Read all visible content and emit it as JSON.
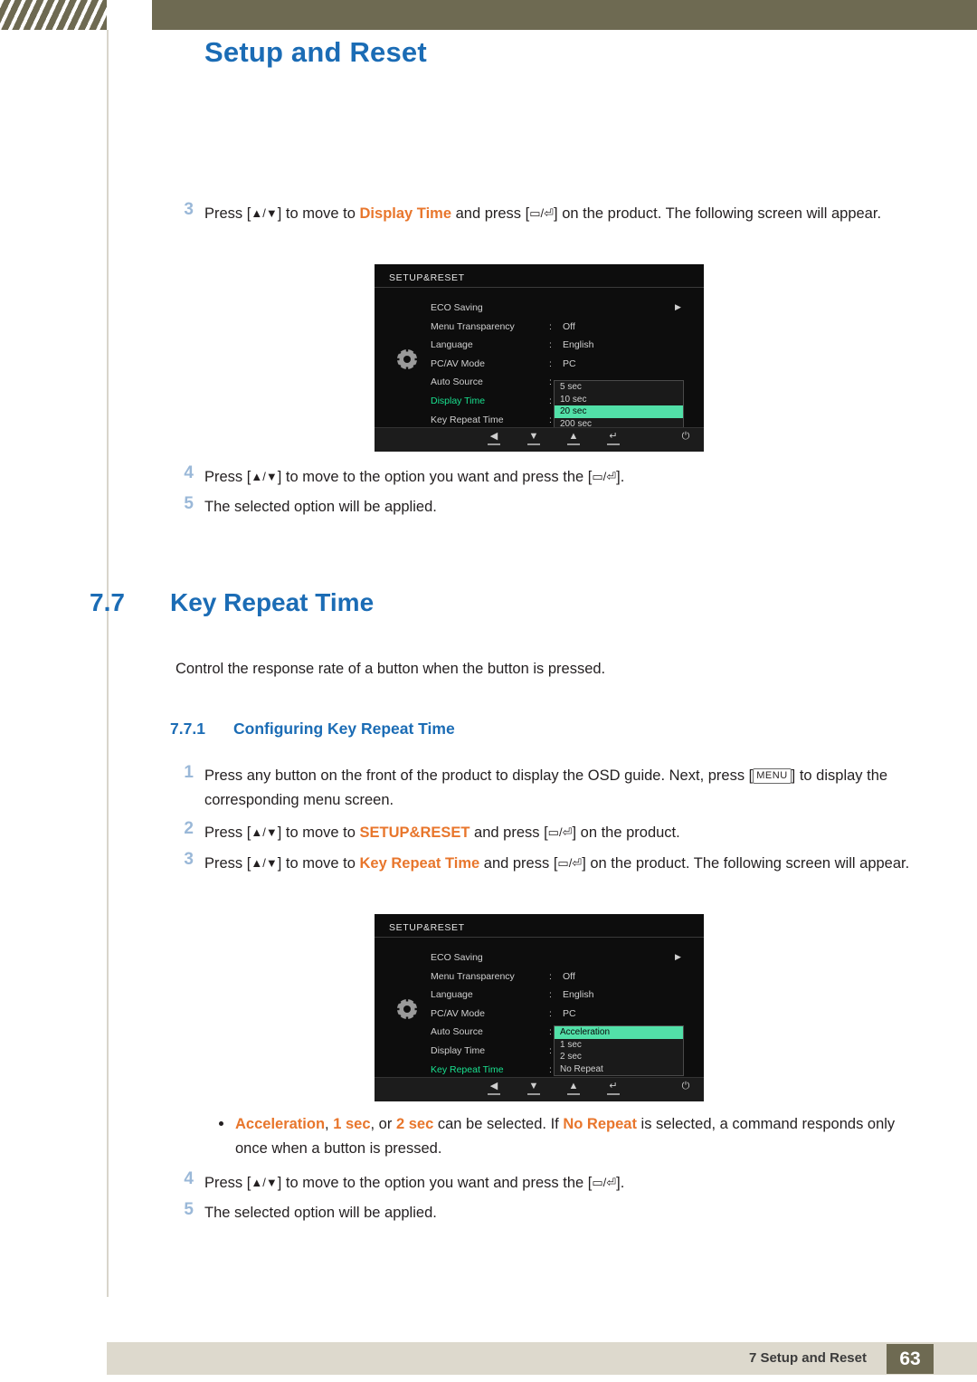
{
  "header": {
    "chapter_title": "Setup and Reset"
  },
  "steps_top": {
    "s3_num": "3",
    "s3_text_a": "Press [",
    "s3_text_b": "] to move to ",
    "s3_display_time": "Display Time",
    "s3_text_c": " and press [",
    "s3_text_d": "] on the product. The following screen will appear.",
    "s4_num": "4",
    "s4_text_a": "Press [",
    "s4_text_b": "] to move to the option you want and press the [",
    "s4_text_c": "].",
    "s5_num": "5",
    "s5_text": "The selected option will be applied."
  },
  "osd_display_time": {
    "title": "SETUP&RESET",
    "rows": [
      {
        "label": "ECO Saving",
        "colon": "",
        "value": "",
        "arrow": "▶",
        "selected": false
      },
      {
        "label": "Menu Transparency",
        "colon": ":",
        "value": "Off",
        "arrow": "",
        "selected": false
      },
      {
        "label": "Language",
        "colon": ":",
        "value": "English",
        "arrow": "",
        "selected": false
      },
      {
        "label": "PC/AV Mode",
        "colon": ":",
        "value": "PC",
        "arrow": "",
        "selected": false
      },
      {
        "label": "Auto Source",
        "colon": ":",
        "value": "",
        "arrow": "",
        "selected": false
      },
      {
        "label": "Display Time",
        "colon": ":",
        "value": "",
        "arrow": "",
        "selected": true
      },
      {
        "label": "Key Repeat Time",
        "colon": ":",
        "value": "",
        "arrow": "",
        "selected": false
      }
    ],
    "popup": [
      {
        "text": "5 sec",
        "highlighted": false
      },
      {
        "text": "10 sec",
        "highlighted": false
      },
      {
        "text": "20 sec",
        "highlighted": true
      },
      {
        "text": "200 sec",
        "highlighted": false
      }
    ],
    "footer_buttons": [
      "◀",
      "▼",
      "▲",
      "↵",
      "⏻"
    ]
  },
  "section": {
    "number": "7.7",
    "title": "Key Repeat Time",
    "description": "Control the response rate of a button when the button is pressed.",
    "sub_number": "7.7.1",
    "sub_title": "Configuring Key Repeat Time"
  },
  "steps_bottom": {
    "s1_num": "1",
    "s1_text_a": "Press any button on the front of the product to display the OSD guide. Next, press [",
    "s1_menu": "MENU",
    "s1_text_b": "] to display the corresponding menu screen.",
    "s2_num": "2",
    "s2_text_a": "Press [",
    "s2_text_b": "] to move to ",
    "s2_target": "SETUP&RESET",
    "s2_text_c": " and press [",
    "s2_text_d": "] on the product.",
    "s3_num": "3",
    "s3_text_a": "Press [",
    "s3_text_b": "] to move to ",
    "s3_target": "Key Repeat Time",
    "s3_text_c": " and press [",
    "s3_text_d": "] on the product. The following screen will appear.",
    "bullet_acceleration": "Acceleration",
    "bullet_comma1": ", ",
    "bullet_1sec": "1 sec",
    "bullet_or": ", or ",
    "bullet_2sec": "2 sec",
    "bullet_mid": " can be selected. If ",
    "bullet_norepeat": "No Repeat",
    "bullet_end": " is selected, a command responds only once when a button is pressed.",
    "s4_num": "4",
    "s4_text_a": "Press [",
    "s4_text_b": "] to move to the option you want and press the [",
    "s4_text_c": "].",
    "s5_num": "5",
    "s5_text": "The selected option will be applied."
  },
  "osd_key_repeat": {
    "title": "SETUP&RESET",
    "rows": [
      {
        "label": "ECO Saving",
        "colon": "",
        "value": "",
        "arrow": "▶",
        "selected": false
      },
      {
        "label": "Menu Transparency",
        "colon": ":",
        "value": "Off",
        "arrow": "",
        "selected": false
      },
      {
        "label": "Language",
        "colon": ":",
        "value": "English",
        "arrow": "",
        "selected": false
      },
      {
        "label": "PC/AV Mode",
        "colon": ":",
        "value": "PC",
        "arrow": "",
        "selected": false
      },
      {
        "label": "Auto Source",
        "colon": ":",
        "value": "",
        "arrow": "",
        "selected": false
      },
      {
        "label": "Display Time",
        "colon": ":",
        "value": "",
        "arrow": "",
        "selected": false
      },
      {
        "label": "Key Repeat Time",
        "colon": ":",
        "value": "",
        "arrow": "",
        "selected": true
      }
    ],
    "popup": [
      {
        "text": "Acceleration",
        "highlighted": true
      },
      {
        "text": "1 sec",
        "highlighted": false
      },
      {
        "text": "2 sec",
        "highlighted": false
      },
      {
        "text": "No Repeat",
        "highlighted": false
      }
    ],
    "footer_buttons": [
      "◀",
      "▼",
      "▲",
      "↵",
      "⏻"
    ]
  },
  "footer": {
    "text": "7 Setup and Reset",
    "page": "63"
  }
}
